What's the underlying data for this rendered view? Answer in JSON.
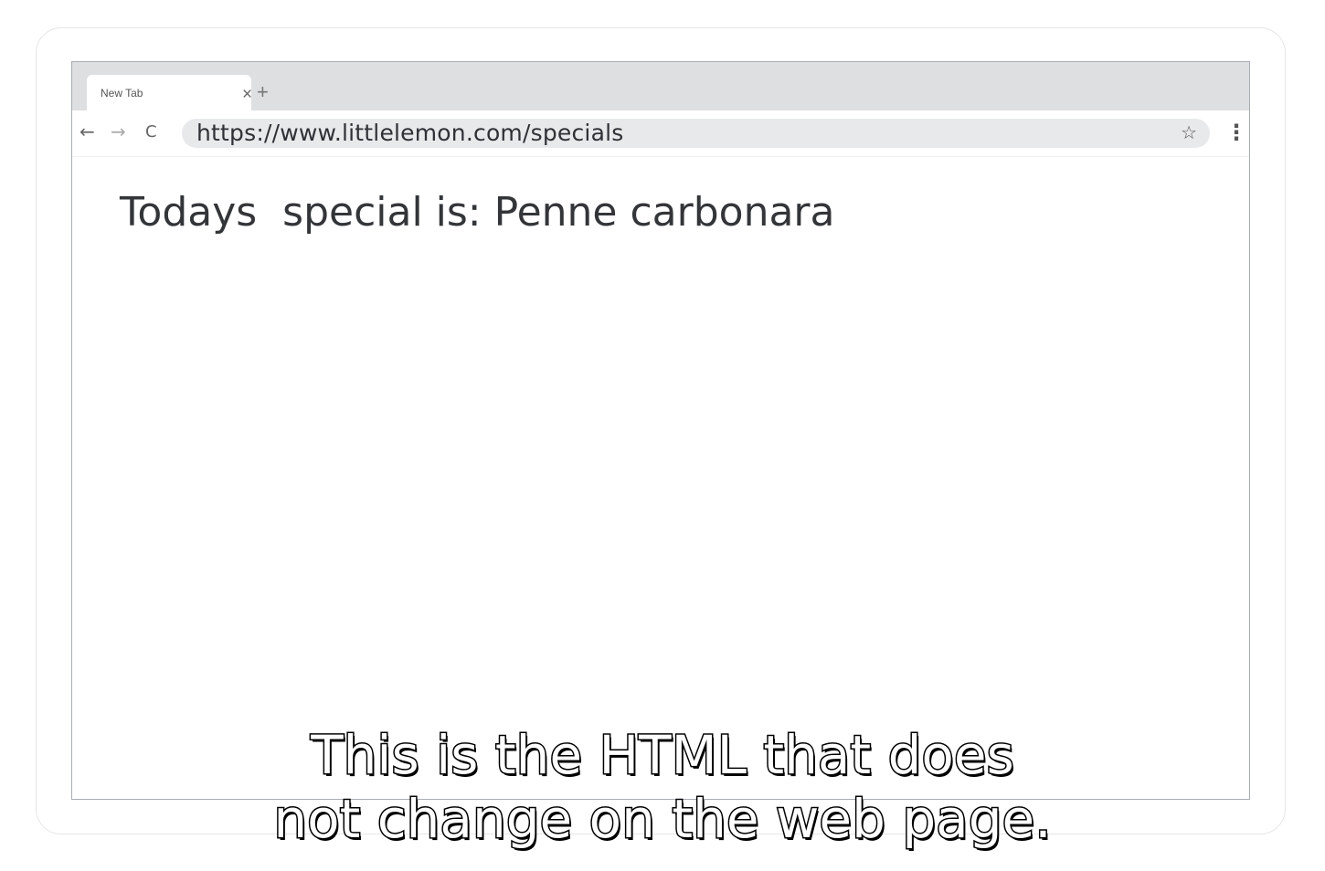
{
  "browser": {
    "tab": {
      "title": "New Tab",
      "close_icon": "close-icon",
      "new_tab_icon": "plus-icon"
    },
    "toolbar": {
      "back_icon": "arrow-left-icon",
      "forward_icon": "arrow-right-icon",
      "reload_icon": "reload-icon",
      "url": "https://www.littlelemon.com/specials",
      "bookmark_icon": "star-icon",
      "menu_icon": "kebab-menu-icon"
    }
  },
  "page": {
    "special_text": "Todays  special is: Penne carbonara"
  },
  "caption": {
    "line1": "This is the HTML that does",
    "line2": "not change on the web page."
  }
}
